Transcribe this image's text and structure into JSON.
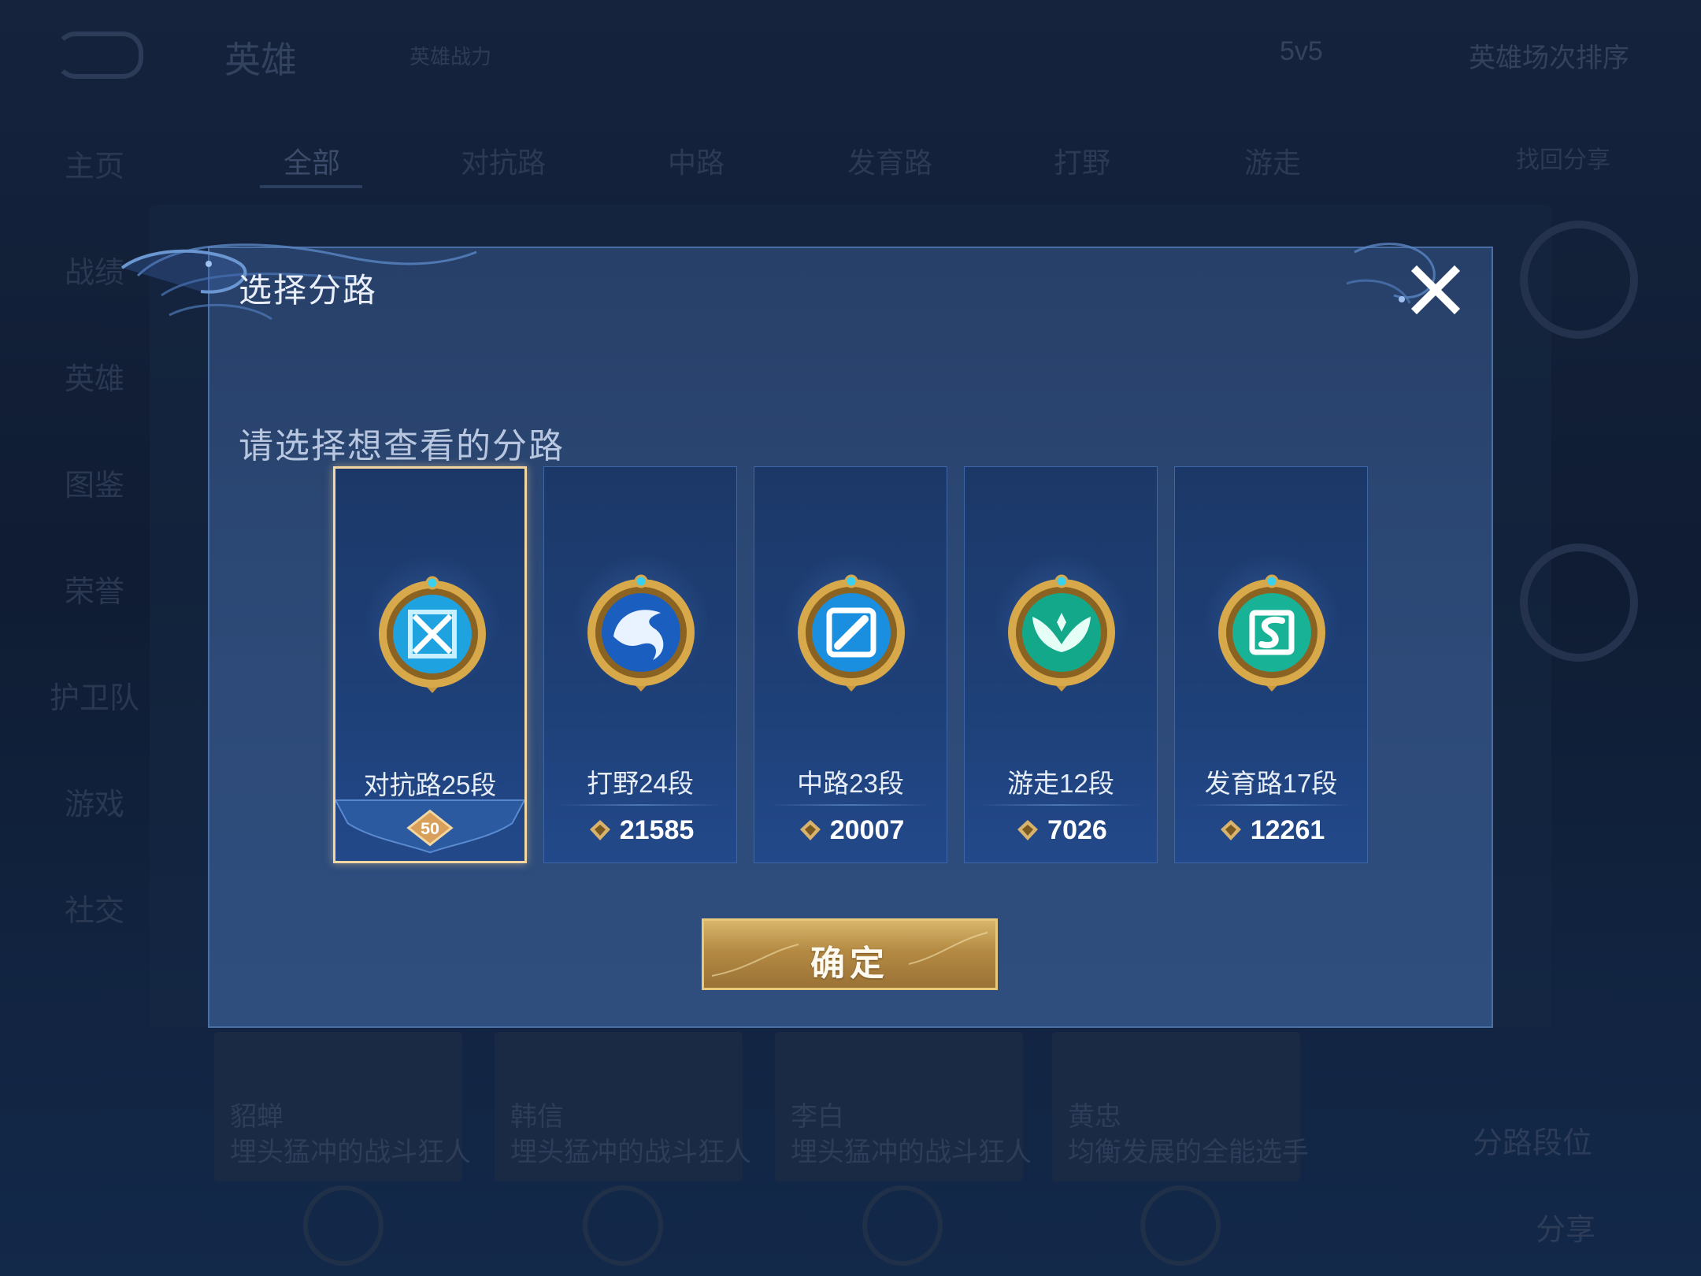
{
  "background": {
    "title": "英雄",
    "subtitle": "英雄战力",
    "mode": "5v5",
    "sort": "英雄场次排序",
    "sidebar": [
      "主页",
      "战绩",
      "英雄",
      "图鉴",
      "荣誉",
      "护卫队",
      "游戏",
      "社交"
    ],
    "tabs": [
      "全部",
      "对抗路",
      "中路",
      "发育路",
      "打野",
      "游走"
    ],
    "tabs_right": "找回分享",
    "right_labels": [
      "分路段位",
      "分享"
    ],
    "cards": [
      {
        "name": "貂蝉",
        "desc": "埋头猛冲的战斗狂人"
      },
      {
        "name": "韩信",
        "desc": "埋头猛冲的战斗狂人"
      },
      {
        "name": "李白",
        "desc": "埋头猛冲的战斗狂人"
      },
      {
        "name": "黄忠",
        "desc": "均衡发展的全能选手"
      }
    ]
  },
  "modal": {
    "title": "选择分路",
    "subtitle": "请选择想查看的分路",
    "confirm_label": "确定",
    "close_icon": "close-icon",
    "lanes": [
      {
        "name": "对抗路25段",
        "rank_badge": "50",
        "points": null,
        "selected": true,
        "emblem": "sword-icon",
        "emblem_color": "#1fa2e0"
      },
      {
        "name": "打野24段",
        "rank_badge": null,
        "points": "21585",
        "selected": false,
        "emblem": "dragon-icon",
        "emblem_color": "#1a5fc0"
      },
      {
        "name": "中路23段",
        "rank_badge": null,
        "points": "20007",
        "selected": false,
        "emblem": "wand-icon",
        "emblem_color": "#1a8fe0"
      },
      {
        "name": "游走12段",
        "rank_badge": null,
        "points": "7026",
        "selected": false,
        "emblem": "wings-icon",
        "emblem_color": "#14a88a"
      },
      {
        "name": "发育路17段",
        "rank_badge": null,
        "points": "12261",
        "selected": false,
        "emblem": "bow-icon",
        "emblem_color": "#18b296"
      }
    ]
  },
  "colors": {
    "modal_bg": "#2d4a78",
    "selected_border": "#f3d6a0",
    "gold_button": "#b48a43"
  }
}
